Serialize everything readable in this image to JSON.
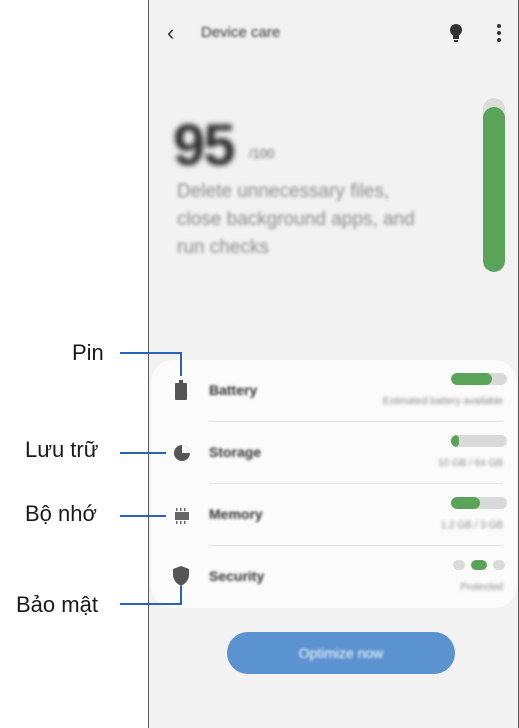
{
  "appbar": {
    "title": "Device care",
    "back_icon": "chevron-left-icon",
    "tips_icon": "lightbulb-icon",
    "more_icon": "more-vertical-icon"
  },
  "score": {
    "value": "95",
    "unit": "/100",
    "description": "Delete unnecessary files, close background apps, and run checks",
    "level_percent": 95
  },
  "items": [
    {
      "label": "Battery",
      "status": "Estimated battery available",
      "icon": "battery-icon",
      "fill_percent": 74
    },
    {
      "label": "Storage",
      "status": "10 GB / 64 GB",
      "icon": "storage-pie-icon",
      "fill_percent": 14
    },
    {
      "label": "Memory",
      "status": "1.2 GB / 3 GB",
      "icon": "memory-chip-icon",
      "fill_percent": 52
    },
    {
      "label": "Security",
      "status": "Protected",
      "icon": "shield-icon"
    }
  ],
  "optimize_button": "Optimize now",
  "callouts": [
    "Pin",
    "Lưu trữ",
    "Bộ nhớ",
    "Bảo mật"
  ],
  "colors": {
    "accent_green": "#5aa45a",
    "accent_blue": "#5b92d0",
    "callout_line": "#2a64b4"
  }
}
